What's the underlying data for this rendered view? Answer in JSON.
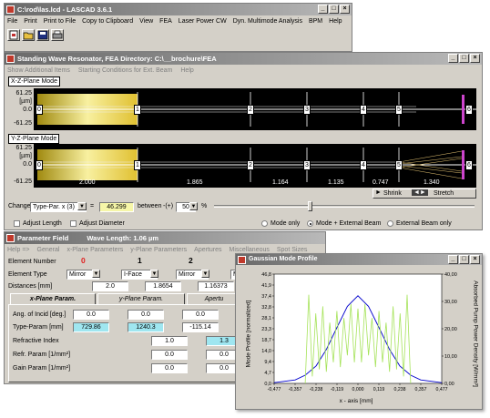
{
  "main": {
    "title": "C:\\rod\\las.lcd - LASCAD 3.6.1",
    "menu": [
      "File",
      "Print",
      "Print to File",
      "Copy to Clipboard",
      "View",
      "FEA",
      "Laser Power CW",
      "Dyn. Multimode Analysis",
      "BPM",
      "Help"
    ]
  },
  "resonator": {
    "title": "Standing Wave Resonator, FEA Directory: C:\\__brochure\\FEA",
    "menu": [
      "Show Additional Items",
      "Starting Conditions for Ext. Beam",
      "Help"
    ],
    "xz_label": "X-Z-Plane Mode",
    "yz_label": "Y-Z-Plane Mode",
    "y_top": "61.25",
    "y_unit": "[µm]",
    "y_mid": "0.0",
    "y_bot": "-61.25",
    "element_labels": [
      "0",
      "1",
      "2",
      "3",
      "4",
      "5",
      "6"
    ],
    "distances": [
      "2.000",
      "1.865",
      "1.164",
      "1.135",
      "0.747",
      "1.340"
    ],
    "shrink_label": "Shrink",
    "stretch_label": "Stretch",
    "change_label": "Change",
    "change_select": "Type-Par. x (3)",
    "equals": "=",
    "change_value": "46.299",
    "between_label": "between",
    "pm_label": "-(+)",
    "range_value": "50",
    "percent": "%",
    "adjust_length": "Adjust Length",
    "adjust_diameter": "Adjust Diameter",
    "mode_only": "Mode only",
    "mode_ext": "Mode + External Beam",
    "ext_only": "External Beam only"
  },
  "param": {
    "title_left": "Parameter Field",
    "title_right": "Wave Length: 1.06 µm",
    "menu": [
      "Help =>",
      "General",
      "x-Plane Parameters",
      "y-Plane Parameters",
      "Apertures",
      "Miscellaneous",
      "Spot Sizes"
    ],
    "element_number_label": "Element Number",
    "element_numbers": [
      "0",
      "1",
      "2",
      "3"
    ],
    "element_type_label": "Element Type",
    "element_types": [
      "Mirror",
      "I-Face",
      "Mirror",
      "M"
    ],
    "distances_label": "Distances [mm]",
    "distances": [
      "2.0",
      "1.8654",
      "1.16373"
    ],
    "tabs": [
      "x-Plane Param.",
      "y-Plane Param.",
      "Apertu"
    ],
    "rows": [
      {
        "label": "Ang. of Incid [deg.]",
        "values": [
          "0.0",
          "0.0",
          "0.0"
        ]
      },
      {
        "label": "Type-Param [mm]",
        "values": [
          "729.86",
          "1240.3",
          "-115.14"
        ]
      },
      {
        "label": "Refractive Index",
        "values": [
          "1.0",
          "1.3"
        ]
      },
      {
        "label": "Refr. Param [1/mm²]",
        "values": [
          "0.0",
          "0.0"
        ]
      },
      {
        "label": "Gain Param [1/mm²]",
        "values": [
          "0.0",
          "0.0"
        ]
      }
    ]
  },
  "gauss": {
    "title": "Gaussian Mode Profile",
    "y_left_label": "Mode Profile [normalized]",
    "y_right_label": "Absorbed Pump Power Density [W/mm³]",
    "x_label": "x - axis [mm]"
  },
  "chart_data": {
    "type": "line",
    "title": "",
    "xlabel": "x - axis [mm]",
    "ylabel": "Mode Profile [normalized]",
    "y2label": "Absorbed Pump Power Density [W/mm³]",
    "xlim": [
      -0.477,
      0.477
    ],
    "ylim": [
      0,
      46.8
    ],
    "y2lim": [
      0,
      40
    ],
    "x_ticks": [
      "-0,477",
      "-0,357",
      "-0,238",
      "-0,119",
      "0,000",
      "0,119",
      "0,238",
      "0,357",
      "0,477"
    ],
    "y_ticks": [
      "0,0",
      "4,7",
      "9,4",
      "14,0",
      "18,7",
      "23,3",
      "28,1",
      "32,8",
      "37,4",
      "41,9",
      "46,8"
    ],
    "y2_ticks": [
      "0,00",
      "10,00",
      "20,00",
      "30,00",
      "40,00"
    ],
    "series": [
      {
        "name": "",
        "color": "#0000cc",
        "x": [
          -0.477,
          -0.357,
          -0.3,
          -0.238,
          -0.18,
          -0.119,
          -0.06,
          0.0,
          0.06,
          0.119,
          0.18,
          0.238,
          0.3,
          0.357,
          0.477
        ],
        "values": [
          0.3,
          1.5,
          3.5,
          7.5,
          14.5,
          24.0,
          33.0,
          37.5,
          33.0,
          24.0,
          14.5,
          7.5,
          3.5,
          1.5,
          0.3
        ]
      },
      {
        "name": "",
        "color": "#a6e35a",
        "x": [
          -0.3,
          -0.28,
          -0.26,
          -0.24,
          -0.22,
          -0.2,
          -0.18,
          -0.16,
          -0.14,
          -0.12,
          -0.1,
          -0.08,
          -0.06,
          -0.04,
          -0.02,
          0.0,
          0.02,
          0.04,
          0.06,
          0.08,
          0.1,
          0.12,
          0.14,
          0.16,
          0.18,
          0.2,
          0.22,
          0.24,
          0.26,
          0.28,
          0.3
        ],
        "values": [
          0,
          38,
          3,
          30,
          6,
          33,
          5,
          26,
          9,
          31,
          7,
          28,
          12,
          34,
          9,
          32,
          9,
          34,
          12,
          28,
          7,
          31,
          9,
          26,
          5,
          33,
          6,
          30,
          3,
          38,
          0
        ]
      }
    ]
  }
}
